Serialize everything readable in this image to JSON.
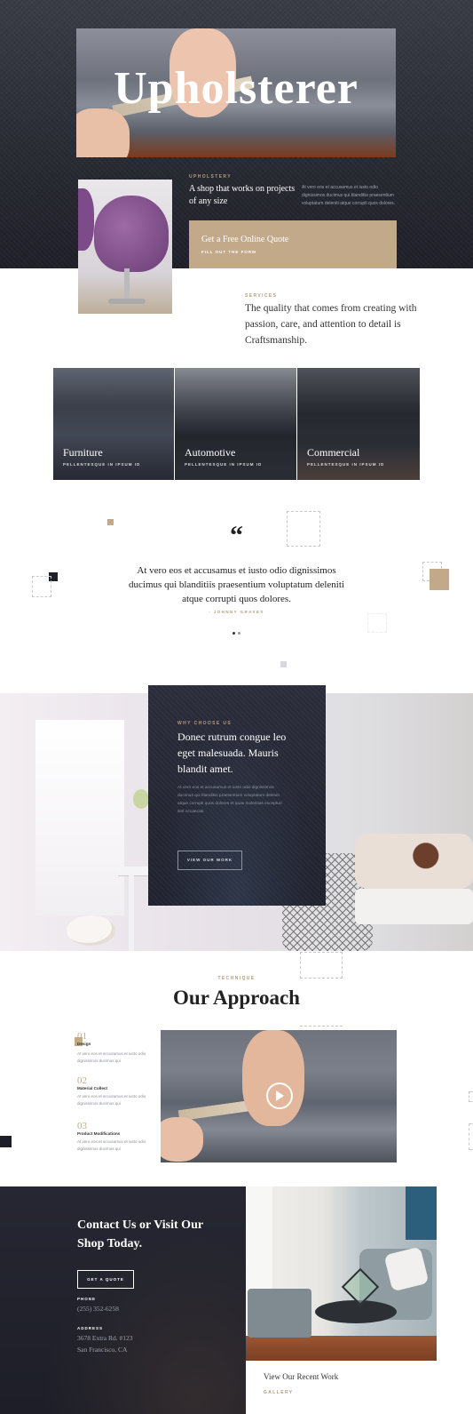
{
  "hero": {
    "title": "Upholsterer",
    "eyebrow": "UPHOLSTERY",
    "tagline": "A shop that works on projects of any size",
    "description": "At vero eos et accusamus et iusto odio dignissimos ducimus qui blanditiis praesentium voluptatum deleniti atque corrupti quos dolores.",
    "cta_title": "Get a Free Online Quote",
    "cta_sub": "FILL OUT THE FORM"
  },
  "services": {
    "eyebrow": "SERVICES",
    "text": "The quality that comes from creating with passion, care, and attention to detail is Craftsmanship.",
    "cards": [
      {
        "name": "Furniture",
        "sub": "PELLENTESQUE IN IPSUM ID"
      },
      {
        "name": "Automotive",
        "sub": "PELLENTESQUE IN IPSUM ID"
      },
      {
        "name": "Commercial",
        "sub": "PELLENTESQUE IN IPSUM ID"
      }
    ]
  },
  "testimonial": {
    "quote_mark": "“",
    "text": "At vero eos et accusamus et iusto odio dignissimos ducimus qui blanditiis praesentium voluptatum deleniti atque corrupti quos dolores.",
    "author": "- JOHNNY GRAVES"
  },
  "why": {
    "eyebrow": "WHY CHOOSE US",
    "title": "Donec rutrum congue leo eget malesuada. Mauris blandit amet.",
    "description": "At vero eos et accusamus et iusto odio dignissimos ducimus qui blanditiis praesentium voluptatum deleniti atque corrupti quos dolores et quas molestias excepturi sint occaecati.",
    "button": "VIEW OUR WORK"
  },
  "approach": {
    "eyebrow": "TECHNIQUE",
    "title": "Our Approach",
    "steps": [
      {
        "num": "01",
        "name": "Design",
        "desc": "At vero eos et accusamus et iusto odio dignissimos ducimus qui"
      },
      {
        "num": "02",
        "name": "Material Collect",
        "desc": "At vero eos et accusamus et iusto odio dignissimos ducimus qui"
      },
      {
        "num": "03",
        "name": "Product Modifications",
        "desc": "At vero eos et accusamus et iusto odio dignissimos ducimus qui"
      }
    ]
  },
  "contact": {
    "title": "Contact Us or Visit Our Shop Today.",
    "button": "GET A QUOTE",
    "phone_label": "PHONE",
    "phone": "(255) 352-6258",
    "address_label": "ADDRESS",
    "address_line1": "3678 Extra Rd. #123",
    "address_line2": "San Francisco, CA"
  },
  "gallery": {
    "title": "View Our Recent Work",
    "sub": "GALLERY"
  },
  "colors": {
    "accent": "#c2a98a",
    "dark": "#1f2029",
    "text": "#222222"
  }
}
